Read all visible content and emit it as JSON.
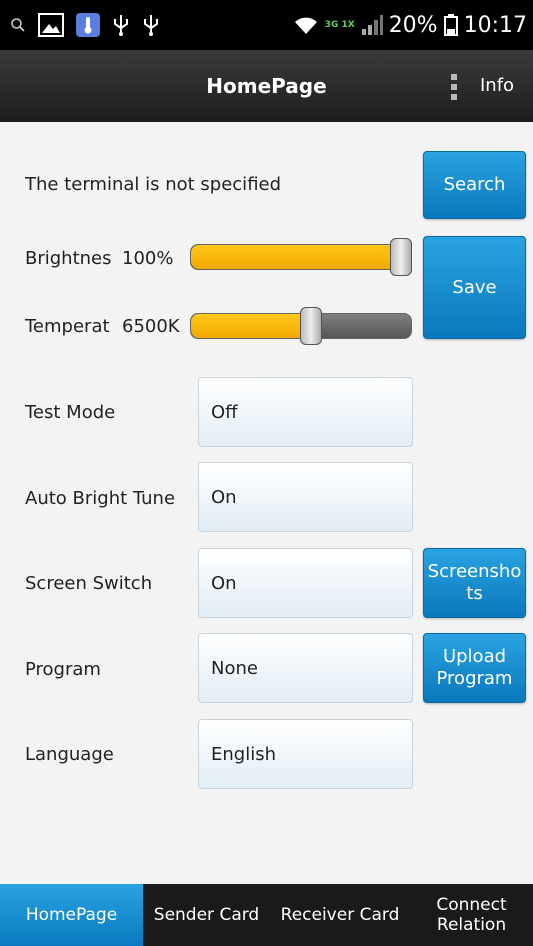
{
  "status_bar": {
    "battery_percent": "20%",
    "time": "10:17",
    "network": "3G 1X"
  },
  "action_bar": {
    "title": "HomePage",
    "info_label": "Info"
  },
  "terminal": {
    "status_text": "The terminal is not specified",
    "search_label": "Search"
  },
  "brightness": {
    "label": "Brightnes",
    "value_text": "100%",
    "level": 1.0
  },
  "temperature": {
    "label": "Temperat",
    "value_text": "6500K",
    "level": 0.55
  },
  "save_label": "Save",
  "settings": [
    {
      "label": "Test Mode",
      "value": "Off"
    },
    {
      "label": "Auto Bright Tune",
      "value": "On"
    },
    {
      "label": "Screen Switch",
      "value": "On"
    },
    {
      "label": "Program",
      "value": "None"
    },
    {
      "label": "Language",
      "value": "English"
    }
  ],
  "screenshots_label": "Screensho ts",
  "upload_program_label": "Upload Program",
  "bottom_tabs": [
    {
      "label": "HomePage"
    },
    {
      "label": "Sender Card"
    },
    {
      "label": "Receiver Card"
    },
    {
      "label": "Connect Relation"
    }
  ]
}
